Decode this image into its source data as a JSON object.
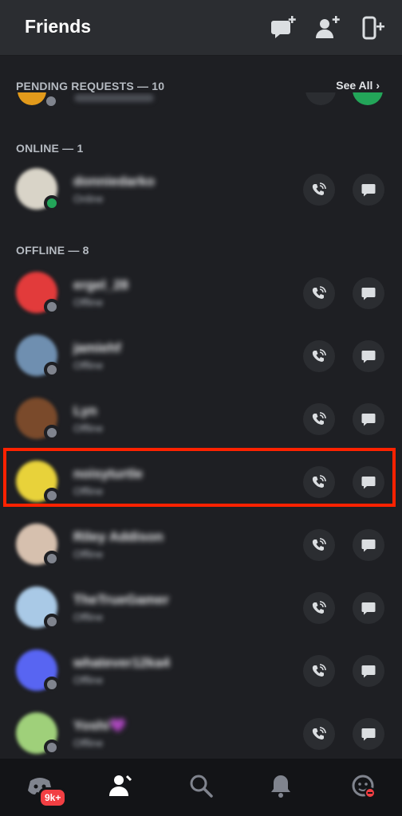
{
  "header": {
    "title": "Friends",
    "icons": [
      "new-message-icon",
      "add-friend-icon",
      "contact-sync-icon"
    ]
  },
  "pending": {
    "label": "PENDING REQUESTS — 10",
    "see_all": "See All ›"
  },
  "online": {
    "label": "ONLINE — 1",
    "friends": [
      {
        "name": "donniedarko",
        "status": "Online",
        "avatar_color": "#d9d4c8",
        "status_color": "#23a559"
      }
    ]
  },
  "offline": {
    "label": "OFFLINE — 8",
    "friends": [
      {
        "name": "ergel_28",
        "status": "Offline",
        "avatar_color": "#e23b3b",
        "status_color": "#80848e"
      },
      {
        "name": "jamiehf",
        "status": "Offline",
        "avatar_color": "#6f8fb0",
        "status_color": "#80848e"
      },
      {
        "name": "Lyn",
        "status": "Offline",
        "avatar_color": "#7a4a2b",
        "status_color": "#80848e"
      },
      {
        "name": "noisyturtle",
        "status": "Offline",
        "avatar_color": "#e8d23a",
        "status_color": "#80848e"
      },
      {
        "name": "Riley Addison",
        "status": "Offline",
        "avatar_color": "#d6c0ae",
        "status_color": "#80848e"
      },
      {
        "name": "TheTrueGamer",
        "status": "Offline",
        "avatar_color": "#a9c9e6",
        "status_color": "#80848e"
      },
      {
        "name": "whatever12ka4",
        "status": "Offline",
        "avatar_color": "#5865f2",
        "status_color": "#80848e"
      },
      {
        "name": "Yoshi💜",
        "status": "Offline",
        "avatar_color": "#9fd07a",
        "status_color": "#80848e"
      }
    ]
  },
  "highlighted_friend": "noisyturtle",
  "bottom_nav": {
    "items": [
      "home-icon",
      "friends-icon",
      "search-icon",
      "notifications-icon",
      "profile-icon"
    ],
    "active": "friends-icon",
    "badge": "9k+"
  },
  "colors": {
    "background": "#1e1f23",
    "header": "#2b2d31",
    "nav": "#131417",
    "highlight": "#ff2200",
    "online": "#23a559",
    "offline": "#80848e",
    "badge": "#f23f43"
  }
}
